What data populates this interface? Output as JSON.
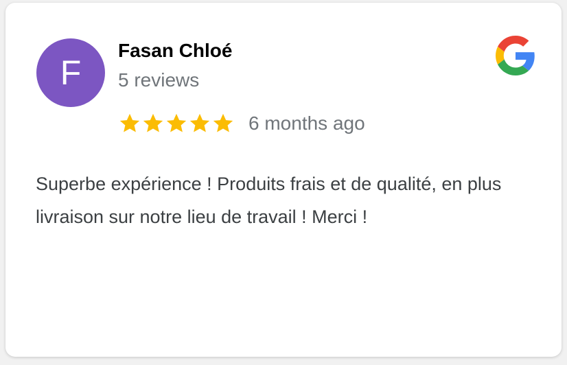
{
  "reviewer": {
    "initial": "F",
    "name": "Fasan Chloé",
    "review_count": "5 reviews",
    "avatar_color": "#7c56c2"
  },
  "rating": {
    "stars": 5,
    "max_stars": 5,
    "star_color": "#fbbc04"
  },
  "time_ago": "6 months ago",
  "review_text": "Superbe expérience ! Produits frais et de qualité, en plus livraison sur notre lieu de travail ! Merci !",
  "source_icon": "google-logo-icon"
}
